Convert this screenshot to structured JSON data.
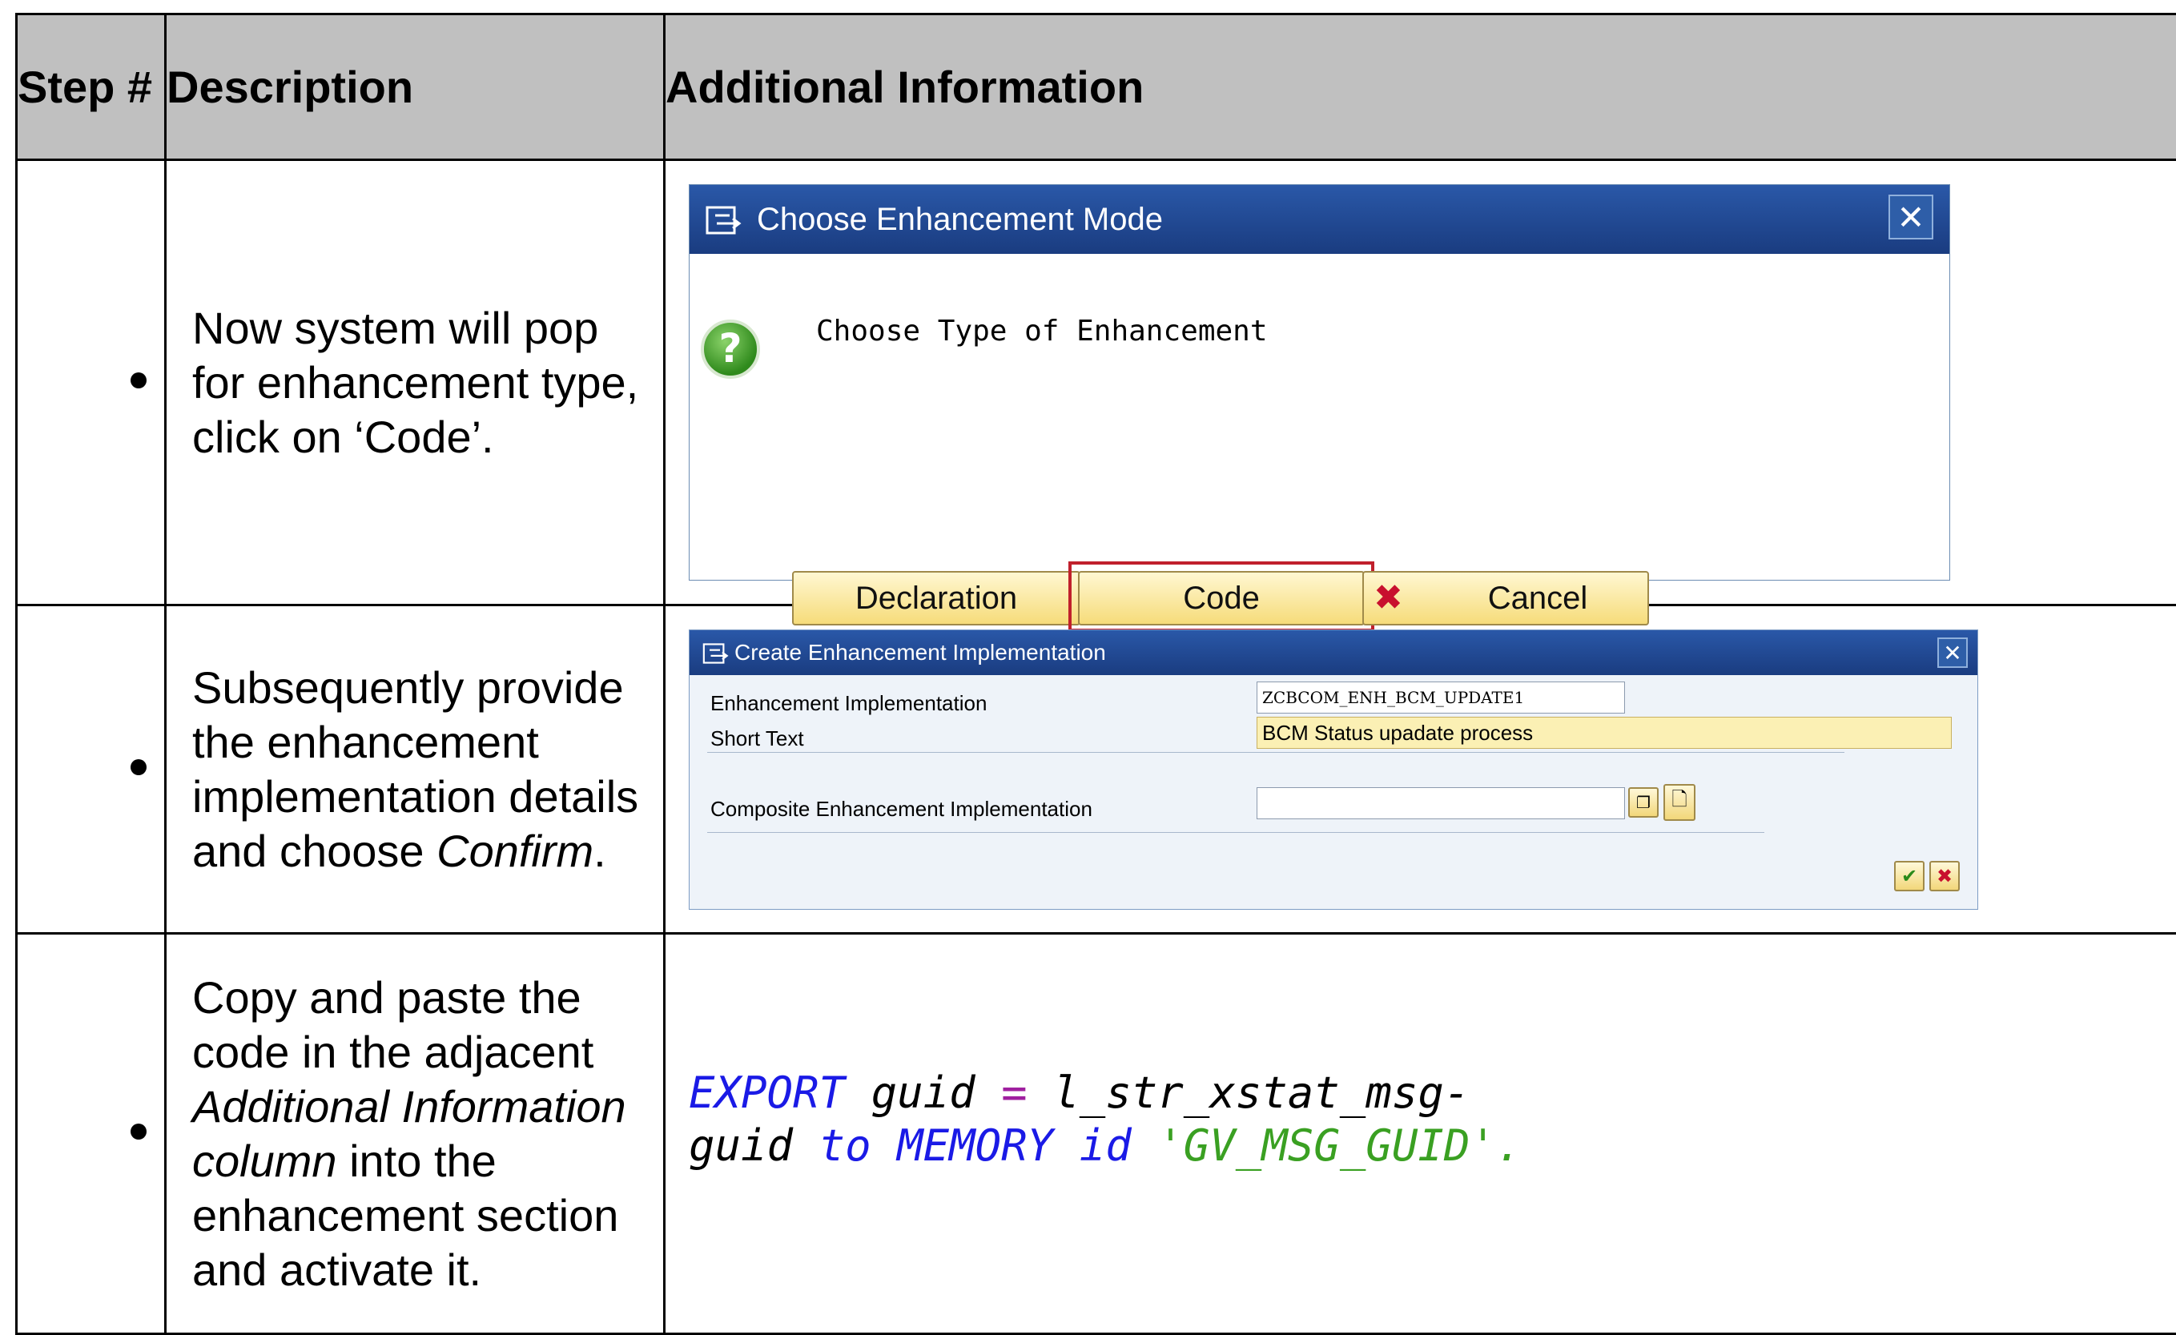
{
  "table": {
    "headers": {
      "step": "Step #",
      "description": "Description",
      "additional": "Additional Information"
    },
    "rows": [
      {
        "description": "Now system will pop for enhancement type, click on ‘Code’."
      },
      {
        "description_pre": "Subsequently provide the enhancement implementation details and choose ",
        "description_em": "Confirm",
        "description_post": "."
      },
      {
        "description_pre": "Copy and paste the code in the adjacent ",
        "description_em": "Additional Information column",
        "description_post": " into the enhancement section and activate it."
      }
    ]
  },
  "dialog_mode": {
    "title": "Choose Enhancement Mode",
    "prompt": "Choose Type of Enhancement",
    "buttons": {
      "declaration": "Declaration",
      "code": "Code",
      "cancel": "Cancel"
    },
    "highlight_color": "#c0202c"
  },
  "dialog_impl": {
    "title": "Create Enhancement Implementation",
    "fields": {
      "impl_label": "Enhancement Implementation",
      "impl_value": "ZCBCOM_ENH_BCM_UPDATE1",
      "short_label": "Short Text",
      "short_value": "BCM Status upadate process",
      "composite_label": "Composite Enhancement Implementation",
      "composite_value": ""
    }
  },
  "code": {
    "l1_kw": "EXPORT",
    "l1_a": " guid ",
    "l1_op": "=",
    "l1_b": " l_str_xstat_msg-",
    "l2_a": "guid ",
    "l2_kw1": "to",
    "l2_sp1": " ",
    "l2_kw2": "MEMORY",
    "l2_sp2": " ",
    "l2_kw3": "id",
    "l2_sp3": " ",
    "l2_str": "'GV_MSG_GUID'."
  }
}
